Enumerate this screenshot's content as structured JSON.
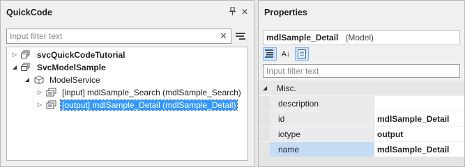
{
  "quickcode": {
    "title": "QuickCode",
    "pin_glyph": "📌",
    "close_glyph": "✕",
    "filter_placeholder": "Input filter text",
    "clear_glyph": "✕",
    "tree": [
      {
        "label": "svcQuickCodeTutorial",
        "bold": true,
        "expander": "collapsed",
        "icon": "service-icon"
      },
      {
        "label": "SvcModelSample",
        "bold": true,
        "expander": "expanded",
        "icon": "service-icon"
      },
      {
        "label": "ModelService",
        "bold": false,
        "expander": "expanded",
        "icon": "model-service-icon"
      },
      {
        "label": "[input] mdlSample_Search (mdlSample_Search)",
        "bold": false,
        "expander": "collapsed",
        "icon": "model-icon"
      },
      {
        "label": "[output] mdlSample_Detail (mdlSample_Detail)",
        "bold": false,
        "expander": "collapsed",
        "icon": "model-icon",
        "selected": true
      }
    ]
  },
  "properties": {
    "title": "Properties",
    "selected_object": "mdlSample_Detail",
    "selected_type": "(Model)",
    "filter_placeholder": "Input filter text",
    "toolbar": {
      "alpha_label": "A↓"
    },
    "category": "Misc.",
    "rows": [
      {
        "name": "description",
        "value": ""
      },
      {
        "name": "id",
        "value": "mdlSample_Detail"
      },
      {
        "name": "iotype",
        "value": "output"
      },
      {
        "name": "name",
        "value": "mdlSample_Detail",
        "selected": true
      }
    ]
  },
  "colors": {
    "selection": "#3399ff",
    "active_button": "#cfe4fb",
    "selected_property": "#c5dcf7"
  }
}
